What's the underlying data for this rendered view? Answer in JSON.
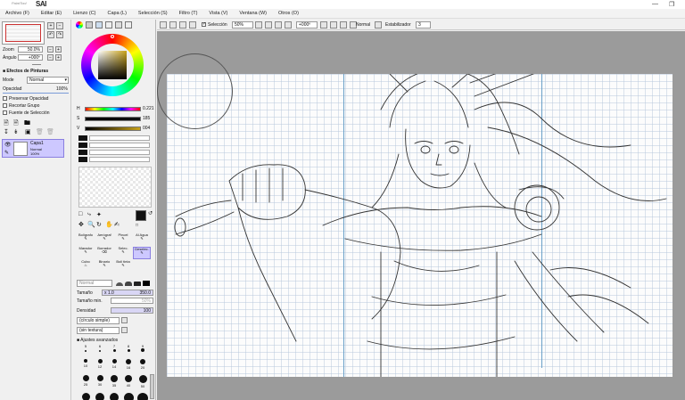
{
  "app": {
    "logo_small": "PaintTool",
    "logo_big": "SAI"
  },
  "menu": [
    {
      "label": "Archivo (F)"
    },
    {
      "label": "Editar (E)"
    },
    {
      "label": "Lienzo (C)"
    },
    {
      "label": "Capa (L)"
    },
    {
      "label": "Selección (S)"
    },
    {
      "label": "Filtro (T)"
    },
    {
      "label": "Vista (V)"
    },
    {
      "label": "Ventana (W)"
    },
    {
      "label": "Otros (O)"
    }
  ],
  "navigator": {
    "zoom_label": "Zoom",
    "zoom_value": "50.0%",
    "angle_label": "Ángulo",
    "angle_value": "+000º"
  },
  "effects": {
    "header": "Efectos de Pinturas",
    "mode_label": "Mode",
    "mode_value": "Normal",
    "opacity_label": "Opacidad",
    "opacity_value": "100%",
    "preserve_opacity": "Preservar Opacidad",
    "clip_group": "Recortar Grupo",
    "selection_source": "Fuente de Selección"
  },
  "layer": {
    "name": "Capa1",
    "mode": "Normal",
    "opacity": "100%"
  },
  "color": {
    "h_label": "H",
    "h_value": "0.221",
    "s_label": "S",
    "s_value": "185",
    "v_label": "V",
    "v_value": "004",
    "foreground": "#111111"
  },
  "tools": {
    "row1": [
      "Bolígrafo",
      "Aerógraf",
      "Pincel",
      "Al Agua"
    ],
    "row2": [
      "Marador",
      "Borrador",
      "Selec.",
      "Deselec."
    ],
    "row3": [
      "Cubo",
      "Binario",
      "Boli tinta"
    ]
  },
  "brush": {
    "mode_value": "Normal",
    "size_label": "Tamaño",
    "size_mult": "x 1.0",
    "size_value": "350.0",
    "min_size_label": "Tamaño min.",
    "min_size_value": "50%",
    "density_label": "Densidad",
    "density_value": "100",
    "shape_value": "(círculo simple)",
    "texture_value": "(sin textura)",
    "advanced_label": "Ajustes avanzados",
    "sizes_row1": [
      "5",
      "6",
      "7",
      "8",
      "9"
    ],
    "sizes_row2": [
      "10",
      "12",
      "14",
      "16",
      "20"
    ],
    "sizes_row3": [
      "25",
      "30",
      "35",
      "40",
      "50"
    ],
    "sizes_row4": [
      "60",
      "70",
      "80",
      "100",
      "120"
    ]
  },
  "canvas_toolbar": {
    "selection_label": "Selección",
    "zoom_value": "50%",
    "angle_value": "+000º",
    "blend_value": "Normal",
    "stabilizer_label": "Estabilizador",
    "stabilizer_value": "3"
  }
}
